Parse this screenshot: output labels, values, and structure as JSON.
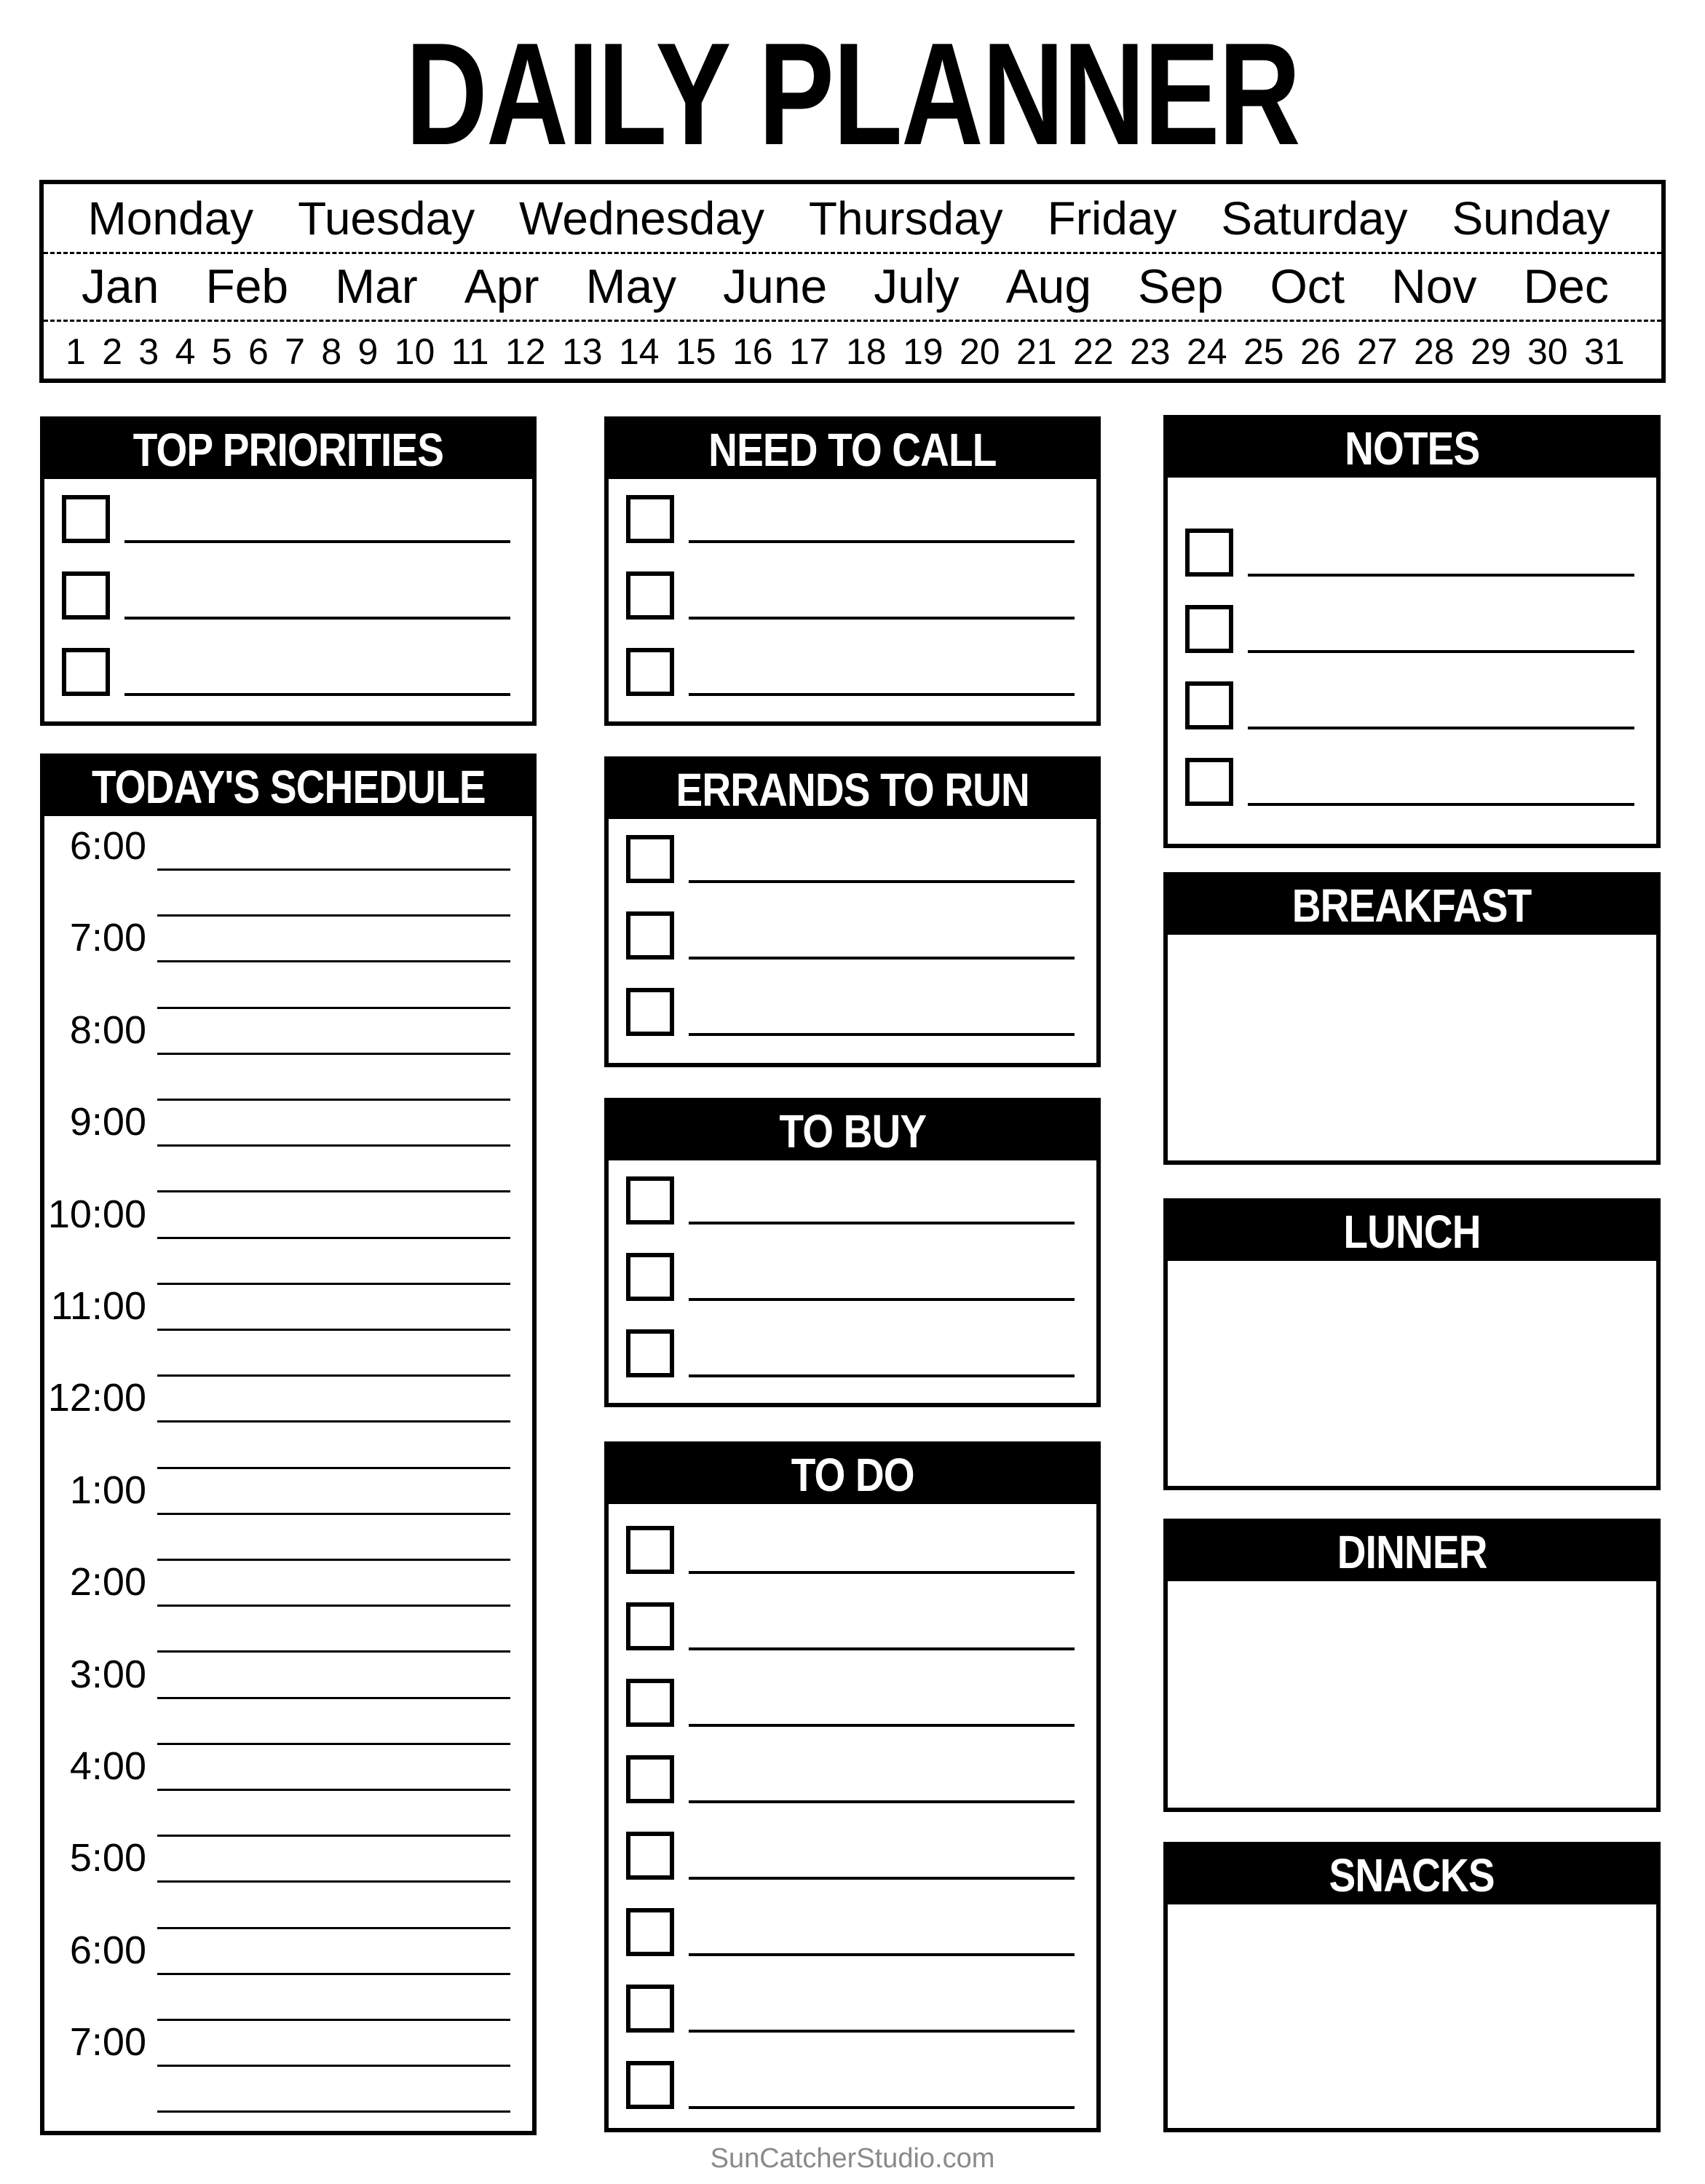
{
  "title": "DAILY PLANNER",
  "calendar": {
    "days": [
      "Monday",
      "Tuesday",
      "Wednesday",
      "Thursday",
      "Friday",
      "Saturday",
      "Sunday"
    ],
    "months": [
      "Jan",
      "Feb",
      "Mar",
      "Apr",
      "May",
      "June",
      "July",
      "Aug",
      "Sep",
      "Oct",
      "Nov",
      "Dec"
    ],
    "dates": [
      "1",
      "2",
      "3",
      "4",
      "5",
      "6",
      "7",
      "8",
      "9",
      "10",
      "11",
      "12",
      "13",
      "14",
      "15",
      "16",
      "17",
      "18",
      "19",
      "20",
      "21",
      "22",
      "23",
      "24",
      "25",
      "26",
      "27",
      "28",
      "29",
      "30",
      "31"
    ]
  },
  "sections": {
    "top_priorities": {
      "label": "TOP PRIORITIES",
      "checkbox_count": 3
    },
    "need_to_call": {
      "label": "NEED TO CALL",
      "checkbox_count": 3
    },
    "notes": {
      "label": "NOTES",
      "checkbox_count": 4
    },
    "errands": {
      "label": "ERRANDS TO RUN",
      "checkbox_count": 3
    },
    "to_buy": {
      "label": "TO BUY",
      "checkbox_count": 3
    },
    "to_do": {
      "label": "TO DO",
      "checkbox_count": 8
    },
    "breakfast": {
      "label": "BREAKFAST"
    },
    "lunch": {
      "label": "LUNCH"
    },
    "dinner": {
      "label": "DINNER"
    },
    "snacks": {
      "label": "SNACKS"
    },
    "schedule": {
      "label": "TODAY'S SCHEDULE",
      "times": [
        "6:00",
        "7:00",
        "8:00",
        "9:00",
        "10:00",
        "11:00",
        "12:00",
        "1:00",
        "2:00",
        "3:00",
        "4:00",
        "5:00",
        "6:00",
        "7:00"
      ]
    }
  },
  "footer": "SunCatcherStudio.com"
}
